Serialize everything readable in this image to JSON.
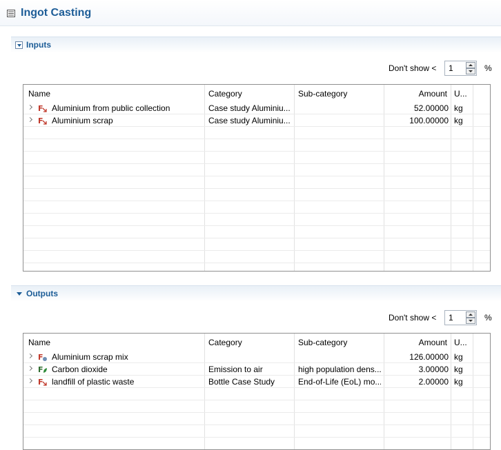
{
  "editor": {
    "title": "Ingot Casting"
  },
  "inputs": {
    "section_label": "Inputs",
    "filter": {
      "label": "Don't show <",
      "value": "1",
      "unit": "%"
    },
    "columns": [
      "Name",
      "Category",
      "Sub-category",
      "Amount",
      "U..."
    ],
    "rows": [
      {
        "name": "Aluminium from public collection",
        "category": "Case study Aluminiu...",
        "subcategory": "",
        "amount": "52.00000",
        "unit": "kg",
        "icon": "product-flow-icon"
      },
      {
        "name": "Aluminium scrap",
        "category": "Case study Aluminiu...",
        "subcategory": "",
        "amount": "100.00000",
        "unit": "kg",
        "icon": "product-flow-icon"
      }
    ]
  },
  "outputs": {
    "section_label": "Outputs",
    "filter": {
      "label": "Don't show <",
      "value": "1",
      "unit": "%"
    },
    "columns": [
      "Name",
      "Category",
      "Sub-category",
      "Amount",
      "U..."
    ],
    "rows": [
      {
        "name": "Aluminium scrap mix",
        "category": "",
        "subcategory": "",
        "amount": "126.00000",
        "unit": "kg",
        "icon": "product-flow-icon"
      },
      {
        "name": "Carbon dioxide",
        "category": "Emission to air",
        "subcategory": "high population dens...",
        "amount": "3.00000",
        "unit": "kg",
        "icon": "elementary-flow-icon"
      },
      {
        "name": "landfill of plastic waste",
        "category": "Bottle Case Study",
        "subcategory": "End-of-Life (EoL) mo...",
        "amount": "2.00000",
        "unit": "kg",
        "icon": "waste-flow-icon"
      }
    ]
  },
  "colors": {
    "accent": "#1d5d97",
    "grid": "#e1e1e1",
    "border": "#8f8f8f",
    "elementary": "#2e8b3a",
    "product": "#c0392b"
  }
}
